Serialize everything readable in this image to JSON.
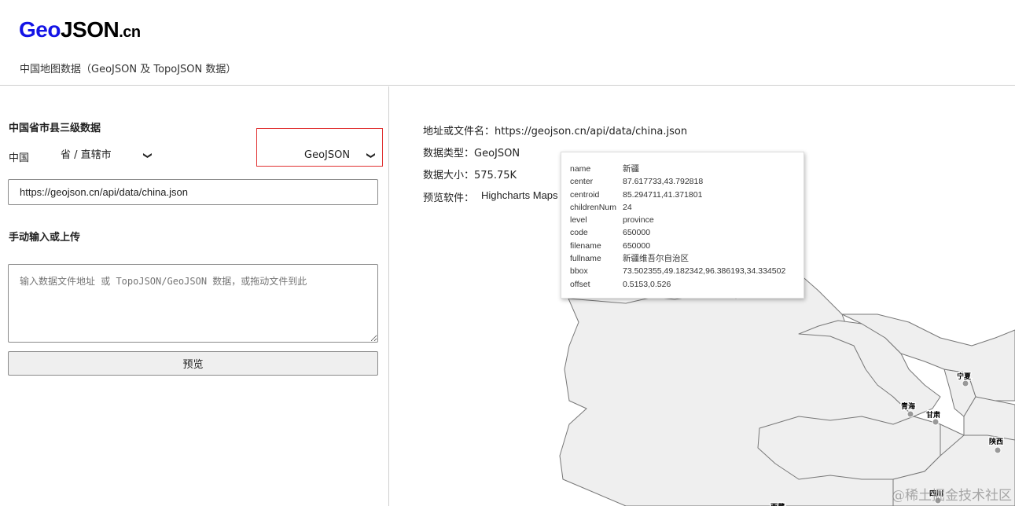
{
  "header": {
    "logo_geo": "Geo",
    "logo_json": "JSON",
    "logo_cn": ".cn",
    "subtitle": "中国地图数据（GeoJSON 及 TopoJSON 数据）"
  },
  "left": {
    "section1_title": "中国省市县三级数据",
    "country_label": "中国",
    "province_select": "省 / 直辖市",
    "format_select": "GeoJSON",
    "url_value": "https://geojson.cn/api/data/china.json",
    "section2_title": "手动输入或上传",
    "textarea_placeholder": "输入数据文件地址 或 TopoJSON/GeoJSON 数据，或拖动文件到此",
    "preview_button": "预览"
  },
  "right": {
    "address_line": "地址或文件名：https://geojson.cn/api/data/china.json",
    "type_line": "数据类型：GeoJSON",
    "size_line": "数据大小：575.75K",
    "software_label": "预览软件：",
    "software_select": "Highcharts Maps"
  },
  "tooltip": {
    "rows": [
      {
        "key": "name",
        "value": "新疆"
      },
      {
        "key": "center",
        "value": "87.617733,43.792818"
      },
      {
        "key": "centroid",
        "value": "85.294711,41.371801"
      },
      {
        "key": "childrenNum",
        "value": "24"
      },
      {
        "key": "level",
        "value": "province"
      },
      {
        "key": "code",
        "value": "650000"
      },
      {
        "key": "filename",
        "value": "650000"
      },
      {
        "key": "fullname",
        "value": "新疆维吾尔自治区"
      },
      {
        "key": "bbox",
        "value": "73.502355,49.182342,96.386193,34.334502"
      },
      {
        "key": "offset",
        "value": "0.5153,0.526"
      }
    ]
  },
  "map": {
    "labels": {
      "ningxia": "宁夏",
      "qinghai": "青海",
      "gansu": "甘肃",
      "shaanxi": "陕西",
      "sichuan": "四川",
      "xizang": "西藏"
    },
    "region_fill": "#efefef",
    "border_color": "#777777"
  },
  "watermark": "@稀土掘金技术社区"
}
